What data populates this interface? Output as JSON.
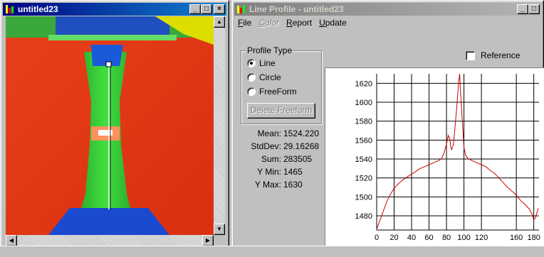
{
  "image_window": {
    "title": "untitled23",
    "buttons": {
      "minimize": "_",
      "maximize": "□",
      "close": "×"
    },
    "scroll": {
      "up": "▲",
      "down": "▼",
      "left": "◀",
      "right": "▶"
    }
  },
  "profile_window": {
    "title": "Line Profile - untitled23",
    "buttons": {
      "minimize": "_",
      "maximize": "□"
    },
    "menu": [
      {
        "label": "File",
        "enabled": true
      },
      {
        "label": "Color",
        "enabled": false
      },
      {
        "label": "Report",
        "enabled": true
      },
      {
        "label": "Update",
        "enabled": true
      }
    ],
    "profile_type": {
      "title": "Profile Type",
      "options": [
        "Line",
        "Circle",
        "FreeForm"
      ],
      "selected": "Line",
      "delete_button": "Delete Freeform"
    },
    "reference_label": "Reference",
    "reference_checked": false,
    "stats": [
      {
        "label": "Mean:",
        "value": "1524.220"
      },
      {
        "label": "StdDev:",
        "value": "29.16268"
      },
      {
        "label": "Sum:",
        "value": "283505"
      },
      {
        "label": "Y Min:",
        "value": "1465"
      },
      {
        "label": "Y Max:",
        "value": "1630"
      }
    ]
  },
  "colors": {
    "title_active": "#000080",
    "plot_line": "#cc0000",
    "plot_bg": "#ffffff"
  },
  "chart_data": {
    "type": "line",
    "title": "",
    "xlabel": "",
    "ylabel": "",
    "xlim": [
      0,
      186
    ],
    "ylim": [
      1465,
      1630
    ],
    "x_ticks": [
      0,
      20,
      40,
      60,
      80,
      100,
      120,
      160,
      180
    ],
    "y_ticks": [
      1480,
      1500,
      1520,
      1540,
      1560,
      1580,
      1600,
      1620
    ],
    "grid": true,
    "series": [
      {
        "x": [
          0,
          2,
          5,
          8,
          12,
          16,
          20,
          25,
          30,
          35,
          40,
          45,
          50,
          55,
          60,
          65,
          70,
          74,
          77,
          80,
          82,
          84,
          85,
          86,
          88,
          90,
          92,
          94,
          95,
          96,
          97,
          98,
          100,
          102,
          104,
          106,
          110,
          115,
          120,
          125,
          130,
          135,
          140,
          145,
          150,
          155,
          160,
          165,
          170,
          175,
          178,
          180,
          182,
          185
        ],
        "y": [
          1466,
          1471,
          1478,
          1486,
          1496,
          1503,
          1509,
          1514,
          1518,
          1521,
          1524,
          1527,
          1530,
          1532,
          1534,
          1536,
          1538,
          1540,
          1546,
          1556,
          1565,
          1560,
          1552,
          1550,
          1556,
          1576,
          1598,
          1622,
          1630,
          1612,
          1598,
          1582,
          1552,
          1544,
          1541,
          1540,
          1538,
          1536,
          1534,
          1532,
          1528,
          1525,
          1520,
          1515,
          1510,
          1506,
          1502,
          1496,
          1492,
          1487,
          1482,
          1476,
          1478,
          1488
        ]
      }
    ]
  }
}
